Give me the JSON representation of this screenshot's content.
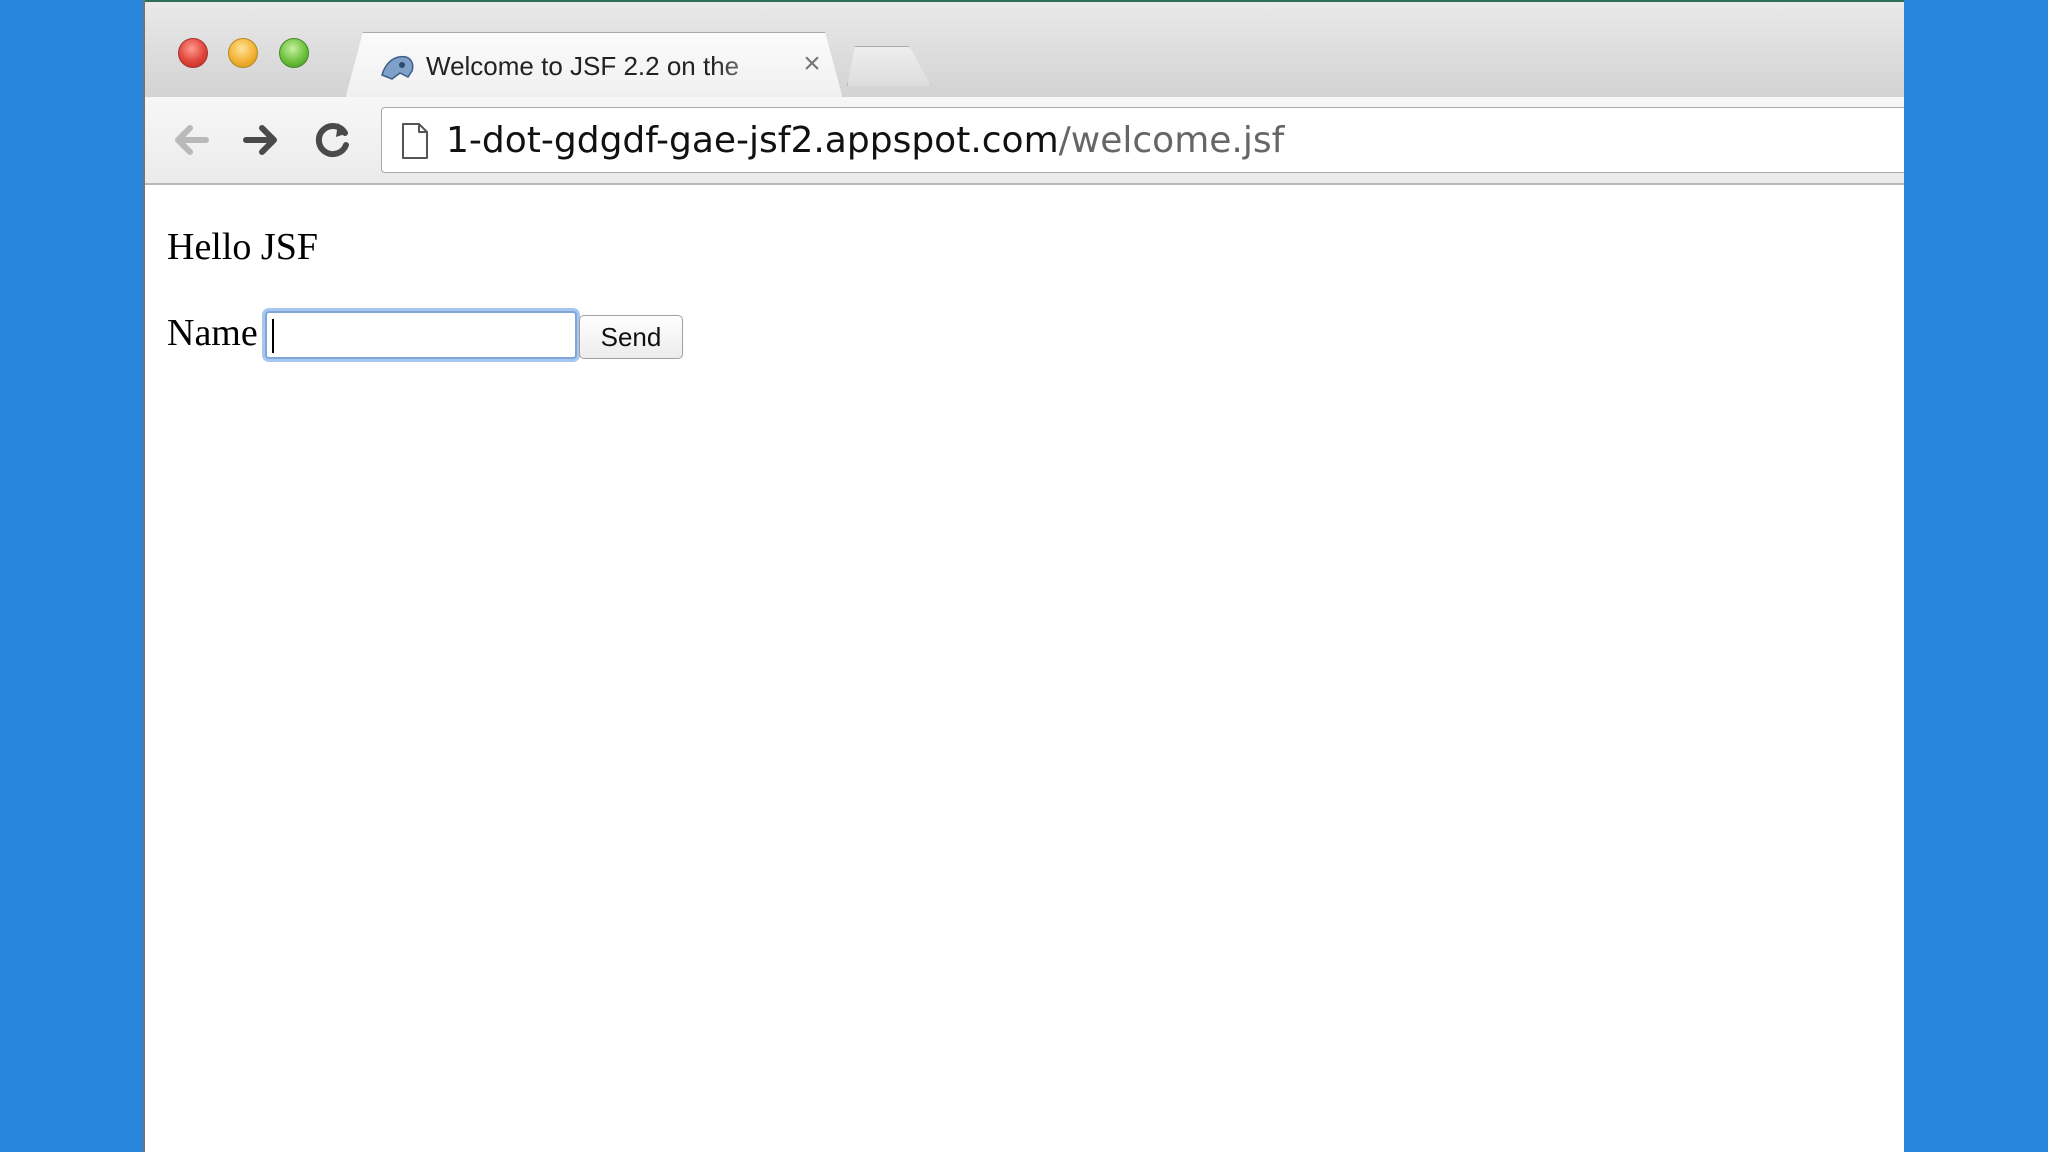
{
  "browser": {
    "tab": {
      "title": "Welcome to JSF 2.2 on the",
      "close_glyph": "×",
      "favicon": "jsf-favicon-icon"
    },
    "new_tab_icon": "new-tab-icon",
    "nav": {
      "back_icon": "arrow-left-icon",
      "forward_icon": "arrow-right-icon",
      "reload_icon": "reload-icon"
    },
    "address": {
      "page_icon": "page-icon",
      "host": "1-dot-gdgdf-gae-jsf2.appspot.com",
      "path": "/welcome.jsf"
    }
  },
  "page": {
    "heading": "Hello JSF",
    "name_label": "Name",
    "name_value": "",
    "send_label": "Send"
  },
  "colors": {
    "background": "#2a86dd",
    "focus_ring": "#a6c8f0"
  }
}
